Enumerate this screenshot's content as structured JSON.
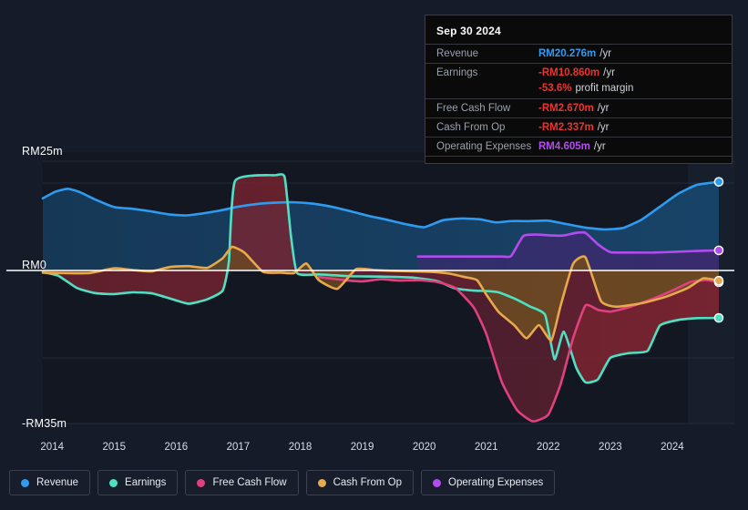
{
  "axis": {
    "y_top_label": "RM25m",
    "y_zero_label": "RM0",
    "y_bottom_label": "-RM35m",
    "x_labels": [
      "2014",
      "2015",
      "2016",
      "2017",
      "2018",
      "2019",
      "2020",
      "2021",
      "2022",
      "2023",
      "2024"
    ]
  },
  "tooltip": {
    "date": "Sep 30 2024",
    "rows": [
      {
        "key": "Revenue",
        "value": "RM20.276m",
        "unit": "/yr",
        "color": "#2e9bf0"
      },
      {
        "key": "Earnings",
        "value": "-RM10.860m",
        "unit": "/yr",
        "color": "#e8342e"
      },
      {
        "key": "",
        "value": "-53.6%",
        "unit": "profit margin",
        "color": "#e8342e"
      },
      {
        "key": "Free Cash Flow",
        "value": "-RM2.670m",
        "unit": "/yr",
        "color": "#e8342e"
      },
      {
        "key": "Cash From Op",
        "value": "-RM2.337m",
        "unit": "/yr",
        "color": "#e8342e"
      },
      {
        "key": "Operating Expenses",
        "value": "RM4.605m",
        "unit": "/yr",
        "color": "#b44bf0"
      }
    ]
  },
  "legend": [
    {
      "label": "Revenue",
      "color": "#2e9bf0"
    },
    {
      "label": "Earnings",
      "color": "#4fe0c4"
    },
    {
      "label": "Free Cash Flow",
      "color": "#e0417e"
    },
    {
      "label": "Cash From Op",
      "color": "#e8a84c"
    },
    {
      "label": "Operating Expenses",
      "color": "#b44bf0"
    }
  ],
  "chart_data": {
    "type": "area",
    "title": "",
    "xlabel": "",
    "ylabel": "RM (millions)",
    "xlim": [
      2013.85,
      2025.0
    ],
    "ylim": [
      -35,
      25
    ],
    "grid": true,
    "zero_line": 0,
    "legend_position": "bottom",
    "currency": "RM",
    "units": "millions",
    "forecast_start": 2024.25,
    "x_tick_values": [
      2014,
      2015,
      2016,
      2017,
      2018,
      2019,
      2020,
      2021,
      2022,
      2023,
      2024
    ],
    "y_tick_values": [
      25,
      0,
      -35
    ],
    "series": [
      {
        "name": "Revenue",
        "color": "#2e9bf0",
        "fill": "#18456b",
        "last_value": 20.276,
        "x": [
          2013.85,
          2014.05,
          2014.25,
          2014.45,
          2014.7,
          2015.0,
          2015.3,
          2015.6,
          2015.9,
          2016.15,
          2016.4,
          2016.7,
          2017.0,
          2017.3,
          2017.6,
          2017.9,
          2018.2,
          2018.5,
          2018.8,
          2019.1,
          2019.4,
          2019.7,
          2020.0,
          2020.3,
          2020.6,
          2020.9,
          2021.15,
          2021.4,
          2021.7,
          2022.0,
          2022.3,
          2022.6,
          2022.9,
          2023.2,
          2023.5,
          2023.8,
          2024.1,
          2024.4,
          2024.75
        ],
        "y": [
          16.5,
          18.0,
          18.7,
          17.9,
          16.2,
          14.5,
          14.1,
          13.5,
          12.8,
          12.6,
          13.0,
          13.7,
          14.6,
          15.2,
          15.5,
          15.6,
          15.3,
          14.6,
          13.6,
          12.5,
          11.6,
          10.6,
          9.9,
          11.5,
          11.9,
          11.7,
          11.0,
          11.3,
          11.3,
          11.4,
          10.6,
          9.8,
          9.4,
          9.7,
          11.6,
          14.6,
          17.6,
          19.6,
          20.276
        ]
      },
      {
        "name": "Earnings",
        "color": "#4fe0c4",
        "fill": "#7a2430",
        "last_value": -10.86,
        "x": [
          2013.85,
          2014.1,
          2014.4,
          2014.7,
          2015.0,
          2015.3,
          2015.6,
          2015.9,
          2016.2,
          2016.5,
          2016.75,
          2016.85,
          2016.95,
          2017.6,
          2017.75,
          2017.85,
          2017.95,
          2018.3,
          2018.8,
          2019.3,
          2019.8,
          2020.2,
          2020.5,
          2020.8,
          2021.0,
          2021.2,
          2021.45,
          2021.7,
          2021.95,
          2022.1,
          2022.25,
          2022.45,
          2022.6,
          2022.8,
          2023.0,
          2023.3,
          2023.6,
          2023.8,
          2024.1,
          2024.4,
          2024.75
        ],
        "y": [
          -0.4,
          -1.2,
          -4.0,
          -5.2,
          -5.4,
          -5.0,
          -5.2,
          -6.4,
          -7.6,
          -6.6,
          -4.6,
          2.0,
          20.5,
          21.8,
          21.3,
          8.0,
          -0.6,
          -0.9,
          -1.3,
          -1.4,
          -1.6,
          -2.4,
          -4.1,
          -4.6,
          -4.7,
          -5.0,
          -6.4,
          -8.2,
          -10.2,
          -20.3,
          -14.0,
          -22.2,
          -25.6,
          -24.9,
          -20.0,
          -18.9,
          -18.4,
          -12.6,
          -11.3,
          -10.9,
          -10.86
        ]
      },
      {
        "name": "Free Cash Flow",
        "color": "#e0417e",
        "fill": "#5a2030",
        "last_value": -2.67,
        "x": [
          2018.3,
          2018.7,
          2019.0,
          2019.3,
          2019.6,
          2019.9,
          2020.2,
          2020.5,
          2020.8,
          2021.0,
          2021.25,
          2021.5,
          2021.75,
          2022.0,
          2022.2,
          2022.4,
          2022.6,
          2022.8,
          2023.0,
          2023.3,
          2023.7,
          2024.0,
          2024.3,
          2024.55,
          2024.75
        ],
        "y": [
          -1.5,
          -2.2,
          -2.5,
          -2.0,
          -2.3,
          -2.2,
          -2.6,
          -4.0,
          -8.5,
          -14.5,
          -25.5,
          -32.0,
          -34.5,
          -33.0,
          -26.0,
          -15.5,
          -8.0,
          -9.0,
          -9.4,
          -8.4,
          -6.4,
          -4.6,
          -2.6,
          -2.2,
          -2.67
        ]
      },
      {
        "name": "Cash From Op",
        "color": "#e8a84c",
        "fill": "#6b4a22",
        "last_value": -2.337,
        "x": [
          2013.85,
          2014.2,
          2014.6,
          2015.0,
          2015.3,
          2015.6,
          2015.9,
          2016.2,
          2016.5,
          2016.75,
          2016.9,
          2017.1,
          2017.4,
          2017.7,
          2017.9,
          2018.1,
          2018.3,
          2018.6,
          2018.9,
          2019.2,
          2019.5,
          2019.8,
          2020.1,
          2020.4,
          2020.65,
          2020.85,
          2021.0,
          2021.2,
          2021.45,
          2021.65,
          2021.85,
          2022.05,
          2022.2,
          2022.4,
          2022.6,
          2022.85,
          2023.1,
          2023.5,
          2023.9,
          2024.25,
          2024.5,
          2024.75
        ],
        "y": [
          -0.5,
          -0.6,
          -0.6,
          0.5,
          0.1,
          -0.2,
          0.8,
          1.0,
          0.6,
          2.8,
          5.4,
          4.1,
          -0.3,
          -0.5,
          -0.6,
          1.6,
          -2.2,
          -4.2,
          0.3,
          0.1,
          -0.1,
          -0.2,
          -0.3,
          -0.7,
          -1.5,
          -2.2,
          -5.5,
          -9.5,
          -12.5,
          -15.5,
          -12.5,
          -16.0,
          -8.0,
          1.5,
          3.0,
          -7.0,
          -8.3,
          -7.5,
          -6.0,
          -4.0,
          -1.8,
          -2.337
        ]
      },
      {
        "name": "Operating Expenses",
        "color": "#b44bf0",
        "fill": "#3a2a6e",
        "last_value": 4.605,
        "x": [
          2019.9,
          2020.3,
          2020.7,
          2021.0,
          2021.25,
          2021.4,
          2021.6,
          2021.85,
          2022.05,
          2022.25,
          2022.45,
          2022.6,
          2022.8,
          2023.0,
          2023.3,
          2023.7,
          2024.1,
          2024.45,
          2024.75
        ],
        "y": [
          3.2,
          3.2,
          3.2,
          3.2,
          3.2,
          3.3,
          7.9,
          8.2,
          8.0,
          8.0,
          8.6,
          8.6,
          6.0,
          4.2,
          4.1,
          4.1,
          4.3,
          4.5,
          4.605
        ]
      }
    ]
  },
  "colors": {
    "background": "#151b28",
    "plot_background": "#12172250",
    "grid": "#2d3648",
    "zero_line": "#ffffff",
    "forecast_band": "#1b2334"
  }
}
